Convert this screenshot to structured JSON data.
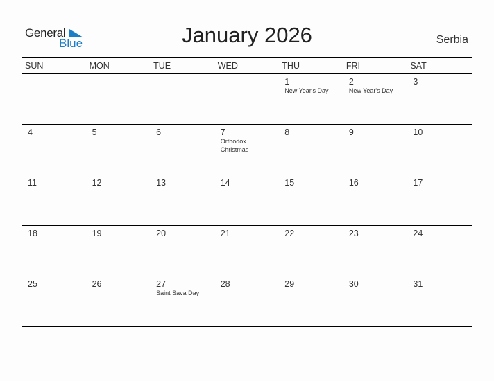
{
  "brand": {
    "word1": "General",
    "word2": "Blue",
    "accent": "#1a7fc4"
  },
  "title": "January 2026",
  "country": "Serbia",
  "weekdays": [
    "SUN",
    "MON",
    "TUE",
    "WED",
    "THU",
    "FRI",
    "SAT"
  ],
  "weeks": [
    [
      {
        "day": "",
        "event": ""
      },
      {
        "day": "",
        "event": ""
      },
      {
        "day": "",
        "event": ""
      },
      {
        "day": "",
        "event": ""
      },
      {
        "day": "1",
        "event": "New Year's Day"
      },
      {
        "day": "2",
        "event": "New Year's Day"
      },
      {
        "day": "3",
        "event": ""
      }
    ],
    [
      {
        "day": "4",
        "event": ""
      },
      {
        "day": "5",
        "event": ""
      },
      {
        "day": "6",
        "event": ""
      },
      {
        "day": "7",
        "event": "Orthodox Christmas"
      },
      {
        "day": "8",
        "event": ""
      },
      {
        "day": "9",
        "event": ""
      },
      {
        "day": "10",
        "event": ""
      }
    ],
    [
      {
        "day": "11",
        "event": ""
      },
      {
        "day": "12",
        "event": ""
      },
      {
        "day": "13",
        "event": ""
      },
      {
        "day": "14",
        "event": ""
      },
      {
        "day": "15",
        "event": ""
      },
      {
        "day": "16",
        "event": ""
      },
      {
        "day": "17",
        "event": ""
      }
    ],
    [
      {
        "day": "18",
        "event": ""
      },
      {
        "day": "19",
        "event": ""
      },
      {
        "day": "20",
        "event": ""
      },
      {
        "day": "21",
        "event": ""
      },
      {
        "day": "22",
        "event": ""
      },
      {
        "day": "23",
        "event": ""
      },
      {
        "day": "24",
        "event": ""
      }
    ],
    [
      {
        "day": "25",
        "event": ""
      },
      {
        "day": "26",
        "event": ""
      },
      {
        "day": "27",
        "event": "Saint Sava Day"
      },
      {
        "day": "28",
        "event": ""
      },
      {
        "day": "29",
        "event": ""
      },
      {
        "day": "30",
        "event": ""
      },
      {
        "day": "31",
        "event": ""
      }
    ]
  ]
}
